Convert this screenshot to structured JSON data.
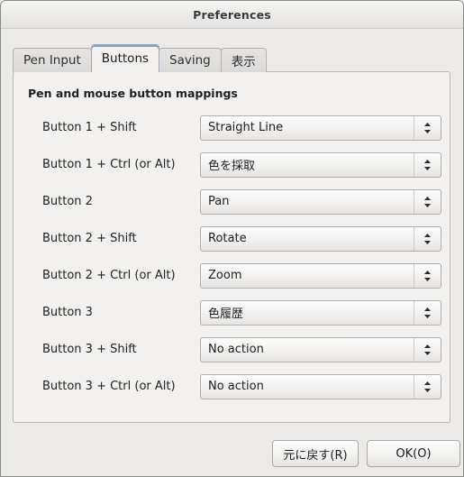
{
  "window": {
    "title": "Preferences"
  },
  "tabs": [
    {
      "label": "Pen Input",
      "active": false
    },
    {
      "label": "Buttons",
      "active": true
    },
    {
      "label": "Saving",
      "active": false
    },
    {
      "label": "表示",
      "active": false
    }
  ],
  "panel": {
    "heading": "Pen and mouse button mappings",
    "rows": [
      {
        "label": "Button 1 + Shift",
        "value": "Straight Line"
      },
      {
        "label": "Button 1 + Ctrl (or Alt)",
        "value": "色を採取"
      },
      {
        "label": "Button 2",
        "value": "Pan"
      },
      {
        "label": "Button 2 + Shift",
        "value": "Rotate"
      },
      {
        "label": "Button 2 + Ctrl (or Alt)",
        "value": "Zoom"
      },
      {
        "label": "Button 3",
        "value": "色履歴"
      },
      {
        "label": "Button 3 + Shift",
        "value": "No action"
      },
      {
        "label": "Button 3 + Ctrl (or Alt)",
        "value": "No action"
      }
    ]
  },
  "footer": {
    "revert_label": "元に戻す(R)",
    "ok_label": "OK(O)"
  },
  "icons": {
    "stepper": "chevron-up-down-icon"
  },
  "colors": {
    "accent": "#7ba3cd",
    "window_bg": "#ebeae8",
    "panel_bg": "#f2f1ef",
    "text": "#1d1d1d"
  }
}
